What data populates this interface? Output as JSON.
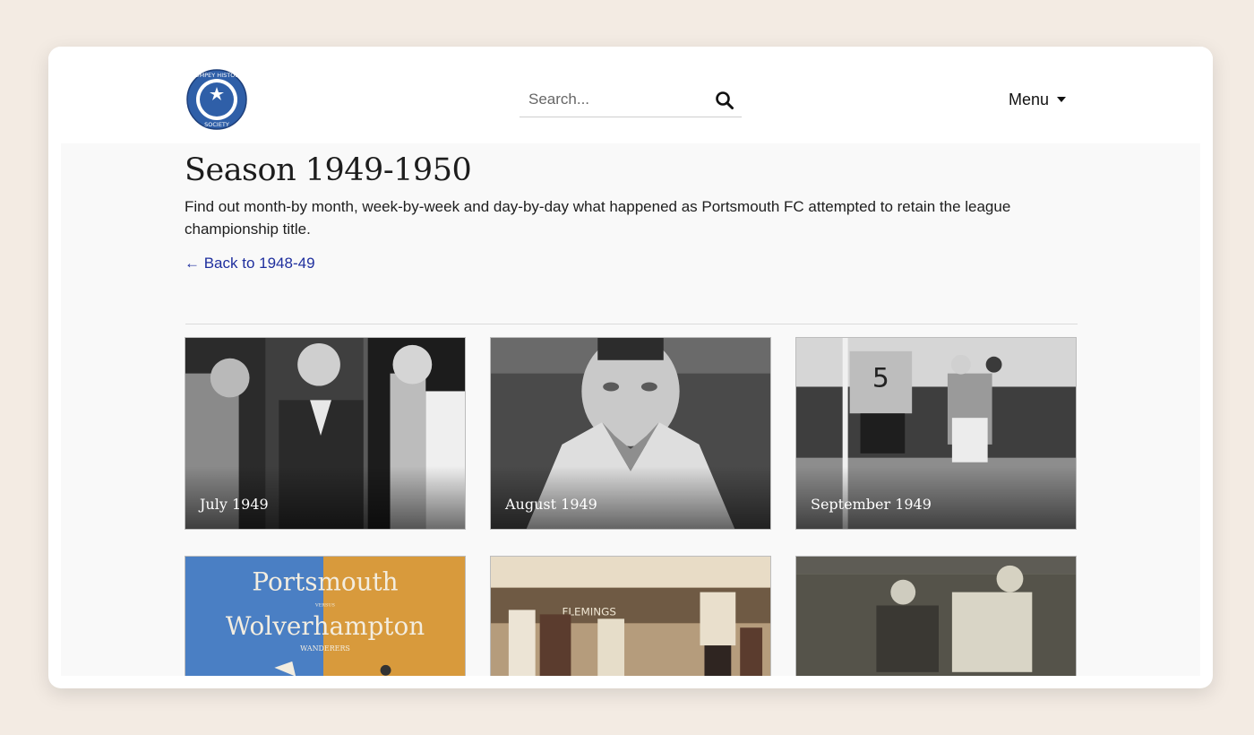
{
  "header": {
    "logo": {
      "ring_text_top": "POMPEY HISTORY",
      "ring_text_bottom": "SOCIETY",
      "icon": "crest-logo"
    },
    "search": {
      "placeholder": "Search...",
      "icon": "search-icon"
    },
    "menu": {
      "label": "Menu",
      "icon": "caret-down-icon"
    }
  },
  "page": {
    "title": "Season 1949-1950",
    "intro": "Find out month-by month, week-by-week and day-by-day what happened as Portsmouth FC attempted to retain the league championship title.",
    "back_link": "← Back to 1948-49"
  },
  "cards": [
    {
      "label": "July 1949"
    },
    {
      "label": "August 1949"
    },
    {
      "label": "September 1949"
    },
    {
      "label": "",
      "poster_title": "Portsmouth",
      "poster_versus": "VERSUS",
      "poster_opponent": "Wolverhampton",
      "poster_sub": "WANDERERS"
    },
    {
      "label": "",
      "stadium_sign": "FLEMINGS"
    },
    {
      "label": ""
    }
  ],
  "colors": {
    "page_bg": "#f3ebe3",
    "link": "#1f2f9e",
    "logo_blue": "#2f5fa8"
  }
}
